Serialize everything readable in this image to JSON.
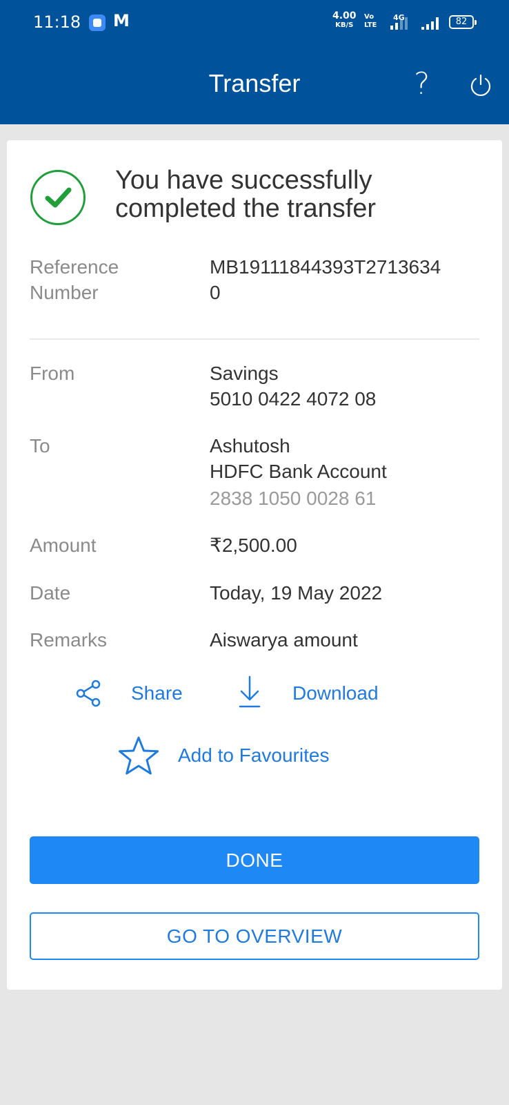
{
  "status_bar": {
    "time": "11:18",
    "speed_value": "4.00",
    "speed_unit": "KB/S",
    "volte": "Vo LTE",
    "network": "4G",
    "battery": "82"
  },
  "header": {
    "title": "Transfer",
    "help_icon": "?",
    "icons": [
      "help-icon",
      "power-icon"
    ],
    "background": "#00529b"
  },
  "confirmation": {
    "message": "You have successfully completed the transfer",
    "icon": "check-circle-icon",
    "icon_color": "#1f9e3a"
  },
  "details": {
    "reference": {
      "label_1": "Reference",
      "label_2": "Number",
      "value_1": "MB19111844393T2713634",
      "value_2": "0"
    },
    "from": {
      "label": "From",
      "account_type": "Savings",
      "account_number": "5010 0422 4072 08"
    },
    "to": {
      "label": "To",
      "name": "Ashutosh",
      "bank": "HDFC Bank Account",
      "account_number": "2838 1050 0028 61"
    },
    "amount": {
      "label": "Amount",
      "value": "₹2,500.00"
    },
    "date": {
      "label": "Date",
      "value": "Today, 19 May 2022"
    },
    "remarks": {
      "label": "Remarks",
      "value": "Aiswarya amount"
    }
  },
  "actions": {
    "share": "Share",
    "download": "Download",
    "favourites": "Add to Favourites",
    "accent": "#1f7ae0"
  },
  "buttons": {
    "done": "DONE",
    "overview": "GO TO OVERVIEW",
    "primary_color": "#1e88f5"
  }
}
